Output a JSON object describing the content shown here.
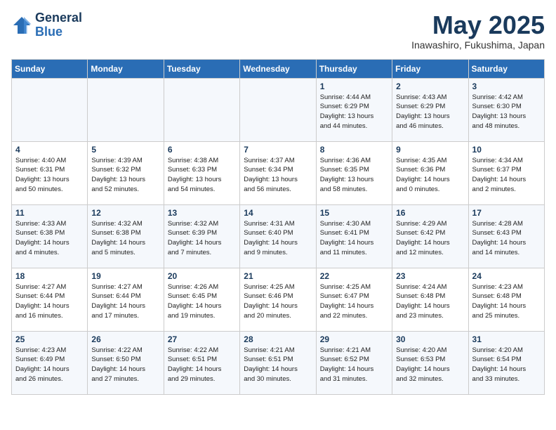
{
  "logo": {
    "line1": "General",
    "line2": "Blue"
  },
  "title": "May 2025",
  "location": "Inawashiro, Fukushima, Japan",
  "weekdays": [
    "Sunday",
    "Monday",
    "Tuesday",
    "Wednesday",
    "Thursday",
    "Friday",
    "Saturday"
  ],
  "weeks": [
    [
      {
        "day": "",
        "info": ""
      },
      {
        "day": "",
        "info": ""
      },
      {
        "day": "",
        "info": ""
      },
      {
        "day": "",
        "info": ""
      },
      {
        "day": "1",
        "info": "Sunrise: 4:44 AM\nSunset: 6:29 PM\nDaylight: 13 hours\nand 44 minutes."
      },
      {
        "day": "2",
        "info": "Sunrise: 4:43 AM\nSunset: 6:29 PM\nDaylight: 13 hours\nand 46 minutes."
      },
      {
        "day": "3",
        "info": "Sunrise: 4:42 AM\nSunset: 6:30 PM\nDaylight: 13 hours\nand 48 minutes."
      }
    ],
    [
      {
        "day": "4",
        "info": "Sunrise: 4:40 AM\nSunset: 6:31 PM\nDaylight: 13 hours\nand 50 minutes."
      },
      {
        "day": "5",
        "info": "Sunrise: 4:39 AM\nSunset: 6:32 PM\nDaylight: 13 hours\nand 52 minutes."
      },
      {
        "day": "6",
        "info": "Sunrise: 4:38 AM\nSunset: 6:33 PM\nDaylight: 13 hours\nand 54 minutes."
      },
      {
        "day": "7",
        "info": "Sunrise: 4:37 AM\nSunset: 6:34 PM\nDaylight: 13 hours\nand 56 minutes."
      },
      {
        "day": "8",
        "info": "Sunrise: 4:36 AM\nSunset: 6:35 PM\nDaylight: 13 hours\nand 58 minutes."
      },
      {
        "day": "9",
        "info": "Sunrise: 4:35 AM\nSunset: 6:36 PM\nDaylight: 14 hours\nand 0 minutes."
      },
      {
        "day": "10",
        "info": "Sunrise: 4:34 AM\nSunset: 6:37 PM\nDaylight: 14 hours\nand 2 minutes."
      }
    ],
    [
      {
        "day": "11",
        "info": "Sunrise: 4:33 AM\nSunset: 6:38 PM\nDaylight: 14 hours\nand 4 minutes."
      },
      {
        "day": "12",
        "info": "Sunrise: 4:32 AM\nSunset: 6:38 PM\nDaylight: 14 hours\nand 5 minutes."
      },
      {
        "day": "13",
        "info": "Sunrise: 4:32 AM\nSunset: 6:39 PM\nDaylight: 14 hours\nand 7 minutes."
      },
      {
        "day": "14",
        "info": "Sunrise: 4:31 AM\nSunset: 6:40 PM\nDaylight: 14 hours\nand 9 minutes."
      },
      {
        "day": "15",
        "info": "Sunrise: 4:30 AM\nSunset: 6:41 PM\nDaylight: 14 hours\nand 11 minutes."
      },
      {
        "day": "16",
        "info": "Sunrise: 4:29 AM\nSunset: 6:42 PM\nDaylight: 14 hours\nand 12 minutes."
      },
      {
        "day": "17",
        "info": "Sunrise: 4:28 AM\nSunset: 6:43 PM\nDaylight: 14 hours\nand 14 minutes."
      }
    ],
    [
      {
        "day": "18",
        "info": "Sunrise: 4:27 AM\nSunset: 6:44 PM\nDaylight: 14 hours\nand 16 minutes."
      },
      {
        "day": "19",
        "info": "Sunrise: 4:27 AM\nSunset: 6:44 PM\nDaylight: 14 hours\nand 17 minutes."
      },
      {
        "day": "20",
        "info": "Sunrise: 4:26 AM\nSunset: 6:45 PM\nDaylight: 14 hours\nand 19 minutes."
      },
      {
        "day": "21",
        "info": "Sunrise: 4:25 AM\nSunset: 6:46 PM\nDaylight: 14 hours\nand 20 minutes."
      },
      {
        "day": "22",
        "info": "Sunrise: 4:25 AM\nSunset: 6:47 PM\nDaylight: 14 hours\nand 22 minutes."
      },
      {
        "day": "23",
        "info": "Sunrise: 4:24 AM\nSunset: 6:48 PM\nDaylight: 14 hours\nand 23 minutes."
      },
      {
        "day": "24",
        "info": "Sunrise: 4:23 AM\nSunset: 6:48 PM\nDaylight: 14 hours\nand 25 minutes."
      }
    ],
    [
      {
        "day": "25",
        "info": "Sunrise: 4:23 AM\nSunset: 6:49 PM\nDaylight: 14 hours\nand 26 minutes."
      },
      {
        "day": "26",
        "info": "Sunrise: 4:22 AM\nSunset: 6:50 PM\nDaylight: 14 hours\nand 27 minutes."
      },
      {
        "day": "27",
        "info": "Sunrise: 4:22 AM\nSunset: 6:51 PM\nDaylight: 14 hours\nand 29 minutes."
      },
      {
        "day": "28",
        "info": "Sunrise: 4:21 AM\nSunset: 6:51 PM\nDaylight: 14 hours\nand 30 minutes."
      },
      {
        "day": "29",
        "info": "Sunrise: 4:21 AM\nSunset: 6:52 PM\nDaylight: 14 hours\nand 31 minutes."
      },
      {
        "day": "30",
        "info": "Sunrise: 4:20 AM\nSunset: 6:53 PM\nDaylight: 14 hours\nand 32 minutes."
      },
      {
        "day": "31",
        "info": "Sunrise: 4:20 AM\nSunset: 6:54 PM\nDaylight: 14 hours\nand 33 minutes."
      }
    ]
  ]
}
